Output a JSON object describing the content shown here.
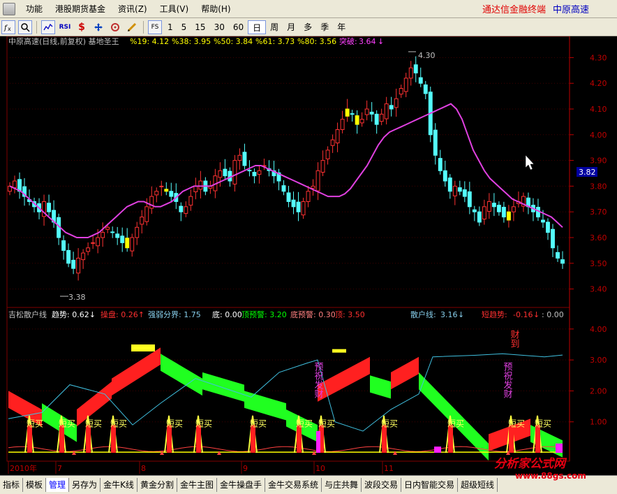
{
  "menubar": {
    "items": [
      "功能",
      "港股期货基金",
      "资讯(Z)",
      "工具(V)",
      "帮助(H)"
    ],
    "brand_left": "通达信金融终端",
    "brand_right": "中原高速"
  },
  "toolbar": {
    "periods": [
      "1",
      "5",
      "15",
      "30",
      "60",
      "日",
      "周",
      "月",
      "多",
      "季",
      "年"
    ],
    "active_period": "日",
    "fs_label": "FS",
    "rsi_label": "RSI"
  },
  "main_panel": {
    "title": "中原高速(日线,前复权) 基地圣王",
    "stats": [
      {
        "label": "%19:",
        "value": "4.12",
        "color": "#ffff00"
      },
      {
        "label": "%38:",
        "value": "3.95",
        "color": "#ffff00"
      },
      {
        "label": "%50:",
        "value": "3.84",
        "color": "#ffff00"
      },
      {
        "label": "%61:",
        "value": "3.73",
        "color": "#ffff00"
      },
      {
        "label": "%80:",
        "value": "3.56",
        "color": "#ffff00"
      }
    ],
    "breakout_label": "突破:",
    "breakout_value": "3.64",
    "high_marker": "4.30",
    "low_marker": "3.38",
    "current_price": "3.82",
    "y_ticks": [
      "4.30",
      "4.20",
      "4.10",
      "4.00",
      "3.90",
      "3.80",
      "3.70",
      "3.60",
      "3.50",
      "3.40"
    ],
    "y_range": [
      3.35,
      4.35
    ]
  },
  "sub_panel": {
    "title": "吉松散户线",
    "items": [
      {
        "label": "趋势:",
        "value": "0.62",
        "arrow": "↓",
        "color": "#ffffff"
      },
      {
        "label": "操盘:",
        "value": "0.26",
        "arrow": "↑",
        "color": "#ff3030"
      },
      {
        "label": "强弱分界:",
        "value": "1.75",
        "arrow": "",
        "color": "#87ceeb"
      },
      {
        "label": "底:",
        "value": "0.00",
        "arrow": "",
        "color": "#ffffff"
      },
      {
        "label": "顶预警:",
        "value": "3.20",
        "arrow": "",
        "color": "#00ff00"
      },
      {
        "label": "底预警:",
        "value": "0.30",
        "arrow": "",
        "color": "#ff8080"
      },
      {
        "label": "顶:",
        "value": "3.50",
        "arrow": "",
        "color": "#ff3030"
      }
    ],
    "retail_label": "散户线:",
    "retail_value": "3.16",
    "short_trend_label": "短趋势:",
    "short_trend_value": "-0.16",
    "colon_value": ": 0.00",
    "y_ticks": [
      "4.00",
      "3.00",
      "2.00",
      "1.00"
    ],
    "buy_label": "短买",
    "annotation_1": "预祝发财",
    "annotation_2": "预祝发财",
    "annotation_3": "财到"
  },
  "x_axis": {
    "labels": [
      "2010年",
      "7",
      "8",
      "9",
      "10",
      "11"
    ]
  },
  "tabs": [
    "指标",
    "模板",
    "管理",
    "另存为",
    "金牛K线",
    "黄金分割",
    "金牛主图",
    "金牛操盘手",
    "金牛交易系统",
    "与庄共舞",
    "波段交易",
    "日内智能交易",
    "超级短线"
  ],
  "active_tab": "管理",
  "watermark": {
    "main": "分析家公式网",
    "sub": "www.88gs.com"
  },
  "chart_data": {
    "type": "candlestick",
    "closes": [
      3.8,
      3.82,
      3.78,
      3.76,
      3.74,
      3.72,
      3.7,
      3.74,
      3.7,
      3.66,
      3.6,
      3.55,
      3.5,
      3.48,
      3.52,
      3.54,
      3.56,
      3.58,
      3.6,
      3.62,
      3.64,
      3.62,
      3.6,
      3.58,
      3.56,
      3.6,
      3.64,
      3.68,
      3.72,
      3.76,
      3.78,
      3.8,
      3.78,
      3.76,
      3.74,
      3.7,
      3.72,
      3.76,
      3.8,
      3.82,
      3.78,
      3.8,
      3.84,
      3.86,
      3.84,
      3.82,
      3.9,
      3.92,
      3.88,
      3.86,
      3.84,
      3.86,
      3.88,
      3.86,
      3.84,
      3.82,
      3.78,
      3.74,
      3.72,
      3.7,
      3.74,
      3.78,
      3.8,
      3.86,
      3.9,
      3.94,
      3.98,
      4.02,
      4.06,
      4.1,
      4.08,
      4.04,
      4.06,
      4.1,
      4.08,
      4.04,
      4.08,
      4.12,
      4.1,
      4.14,
      4.18,
      4.22,
      4.26,
      4.24,
      4.2,
      4.16,
      4.0,
      3.92,
      3.86,
      3.82,
      3.78,
      3.8,
      3.78,
      3.76,
      3.72,
      3.7,
      3.66,
      3.72,
      3.74,
      3.72,
      3.7,
      3.68,
      3.7,
      3.72,
      3.74,
      3.76,
      3.72,
      3.7,
      3.68,
      3.66,
      3.62,
      3.56,
      3.52,
      3.5
    ],
    "ma": [
      3.8,
      3.79,
      3.78,
      3.76,
      3.74,
      3.72,
      3.7,
      3.68,
      3.66,
      3.64,
      3.62,
      3.61,
      3.6,
      3.6,
      3.6,
      3.61,
      3.62,
      3.64,
      3.66,
      3.68,
      3.7,
      3.72,
      3.73,
      3.74,
      3.74,
      3.73,
      3.72,
      3.72,
      3.73,
      3.74,
      3.76,
      3.78,
      3.79,
      3.8,
      3.8,
      3.8,
      3.8,
      3.81,
      3.82,
      3.83,
      3.84,
      3.85,
      3.86,
      3.87,
      3.88,
      3.88,
      3.87,
      3.86,
      3.85,
      3.84,
      3.83,
      3.82,
      3.81,
      3.8,
      3.79,
      3.78,
      3.77,
      3.76,
      3.76,
      3.76,
      3.77,
      3.79,
      3.82,
      3.85,
      3.88,
      3.92,
      3.96,
      3.99,
      4.01,
      4.02,
      4.03,
      4.04,
      4.05,
      4.06,
      4.07,
      4.08,
      4.09,
      4.1,
      4.11,
      4.12,
      4.1,
      4.06,
      4.0,
      3.94,
      3.9,
      3.86,
      3.83,
      3.81,
      3.79,
      3.77,
      3.75,
      3.74,
      3.73,
      3.72,
      3.71,
      3.7,
      3.69,
      3.68,
      3.66,
      3.64
    ],
    "y_range": [
      3.35,
      4.35
    ]
  }
}
